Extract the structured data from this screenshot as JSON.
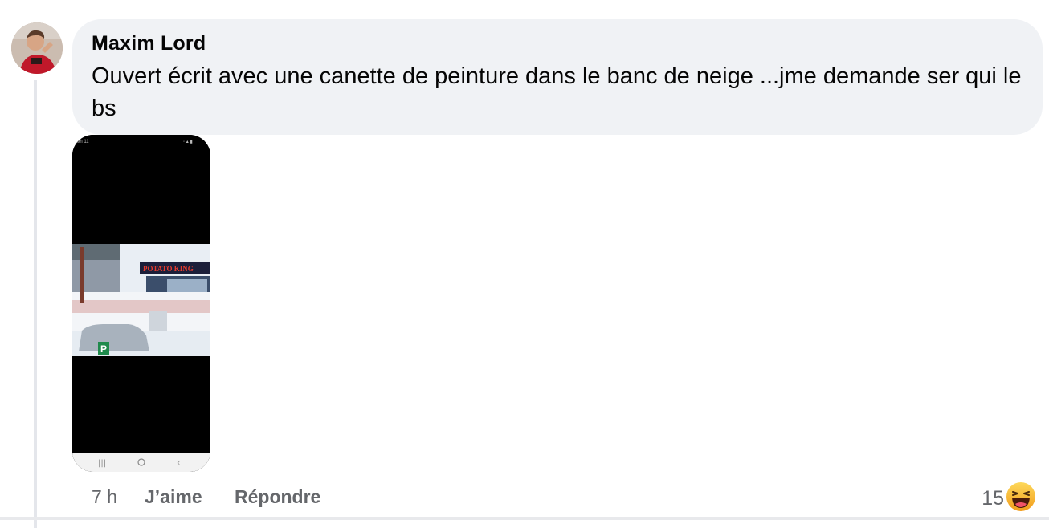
{
  "comment": {
    "author": "Maxim Lord",
    "text": "Ouvert écrit avec une canette de peinture dans le banc de neige ...jme demande ser qui le bs",
    "attachment": {
      "status_time": "9h 11",
      "sign_text": "POTATO KING",
      "parking_letter": "P"
    },
    "time_ago": "7 h",
    "like_label": "J’aime",
    "reply_label": "Répondre",
    "reaction_count": "15",
    "reaction_icon": "haha-emoji-icon"
  },
  "colors": {
    "bubble_bg": "#f0f2f5",
    "text": "#050505",
    "secondary_text": "#65676b",
    "thread_line": "#e4e6eb",
    "reaction_yellow": "#f7b125"
  }
}
